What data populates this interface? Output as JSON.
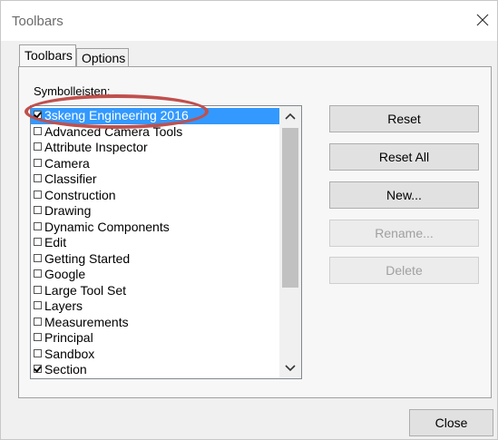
{
  "window": {
    "title": "Toolbars"
  },
  "tabs": [
    {
      "label": "Toolbars",
      "active": true
    },
    {
      "label": "Options",
      "active": false
    }
  ],
  "list": {
    "label": "Symbolleisten:",
    "items": [
      {
        "label": "3skeng Engineering 2016",
        "checked": true,
        "selected": true
      },
      {
        "label": "Advanced Camera Tools",
        "checked": false,
        "selected": false
      },
      {
        "label": "Attribute Inspector",
        "checked": false,
        "selected": false
      },
      {
        "label": "Camera",
        "checked": false,
        "selected": false
      },
      {
        "label": "Classifier",
        "checked": false,
        "selected": false
      },
      {
        "label": "Construction",
        "checked": false,
        "selected": false
      },
      {
        "label": "Drawing",
        "checked": false,
        "selected": false
      },
      {
        "label": "Dynamic Components",
        "checked": false,
        "selected": false
      },
      {
        "label": "Edit",
        "checked": false,
        "selected": false
      },
      {
        "label": "Getting Started",
        "checked": false,
        "selected": false
      },
      {
        "label": "Google",
        "checked": false,
        "selected": false
      },
      {
        "label": "Large Tool Set",
        "checked": false,
        "selected": false
      },
      {
        "label": "Layers",
        "checked": false,
        "selected": false
      },
      {
        "label": "Measurements",
        "checked": false,
        "selected": false
      },
      {
        "label": "Principal",
        "checked": false,
        "selected": false
      },
      {
        "label": "Sandbox",
        "checked": false,
        "selected": false
      },
      {
        "label": "Section",
        "checked": true,
        "selected": false
      }
    ]
  },
  "buttons": {
    "reset": "Reset",
    "reset_all": "Reset All",
    "new": "New...",
    "rename": "Rename...",
    "delete": "Delete",
    "close": "Close"
  },
  "colors": {
    "selection": "#3399ff",
    "annotation": "#c0504d"
  }
}
